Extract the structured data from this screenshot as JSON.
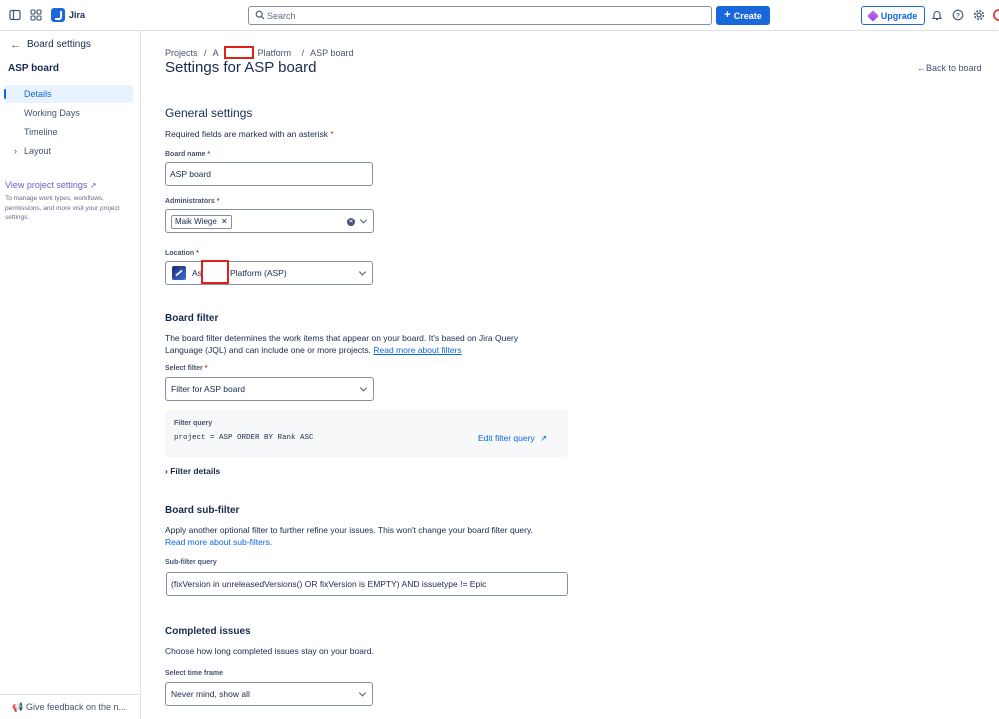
{
  "topbar": {
    "app_name": "Jira",
    "search_placeholder": "Search",
    "create_label": "Create",
    "upgrade_label": "Upgrade"
  },
  "sidebar": {
    "title": "Board settings",
    "board_name": "ASP board",
    "items": [
      {
        "label": "Details",
        "active": true
      },
      {
        "label": "Working Days",
        "active": false
      },
      {
        "label": "Timeline",
        "active": false
      },
      {
        "label": "Layout",
        "active": false
      }
    ],
    "project_link": "View project settings",
    "project_help": "To manage work types, workflows, permissions, and more visit your project settings.",
    "feedback": "Give feedback on the n..."
  },
  "breadcrumbs": {
    "projects": "Projects",
    "sep": "/",
    "project_prefix": "A",
    "project_suffix": "Platform",
    "board": "ASP board"
  },
  "page": {
    "title": "Settings for ASP board",
    "back_to_board": "Back to board"
  },
  "general": {
    "heading": "General settings",
    "required_note": "Required fields are marked with an asterisk",
    "asterisk": "*",
    "board_name_label": "Board name",
    "board_name_value": "ASP board",
    "administrators_label": "Administrators",
    "administrator_tag": "Maik Wiege",
    "location_label": "Location",
    "location_prefix": "As",
    "location_suffix": "Platform (ASP)"
  },
  "board_filter": {
    "heading": "Board filter",
    "description": "The board filter determines the work items that appear on your board. It's based on Jira Query Language (JQL) and can include one or more projects.",
    "link": "Read more about filters",
    "select_label": "Select filter",
    "select_value": "Filter for ASP board",
    "query_label": "Filter query",
    "query_value": "project = ASP ORDER BY Rank ASC",
    "edit_link": "Edit filter query",
    "details_label": "Filter details"
  },
  "sub_filter": {
    "heading": "Board sub-filter",
    "description": "Apply another optional filter to further refine your issues. This won't change your board filter query.",
    "link": "Read more about sub-filters.",
    "query_label": "Sub-filter query",
    "query_value": "(fixVersion in unreleasedVersions() OR fixVersion is EMPTY) AND issuetype != Epic"
  },
  "completed": {
    "heading": "Completed issues",
    "description": "Choose how long completed issues stay on your board.",
    "time_label": "Select time frame",
    "time_value": "Never mind, show all"
  },
  "colors": {
    "primary": "#1868db",
    "link": "#0c66e4",
    "sidebar_active_bg": "#e9f2ff",
    "required": "#c9372c",
    "redaction": "#e2211c"
  }
}
